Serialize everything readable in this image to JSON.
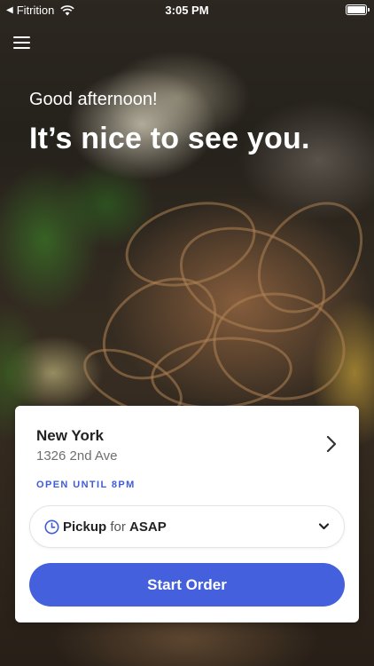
{
  "status_bar": {
    "back_app": "Fitrition",
    "time": "3:05 PM",
    "back_icon": "back-arrow-icon",
    "wifi_icon": "wifi-icon",
    "battery_icon": "battery-icon",
    "battery_level": 1.0
  },
  "header": {
    "menu_icon": "hamburger-menu-icon",
    "greeting": "Good afternoon!",
    "title": "It’s nice to see you."
  },
  "location": {
    "name": "New York",
    "address": "1326 2nd Ave",
    "hours": "OPEN UNTIL 8PM",
    "chevron_icon": "chevron-right-icon"
  },
  "order_type": {
    "icon": "clock-icon",
    "mode": "Pickup",
    "connector": "for",
    "time": "ASAP",
    "dropdown_icon": "chevron-down-icon"
  },
  "actions": {
    "start_order": "Start Order"
  },
  "colors": {
    "accent": "#4560dd",
    "hours_text": "#3f5bd9",
    "card_bg": "#ffffff"
  }
}
